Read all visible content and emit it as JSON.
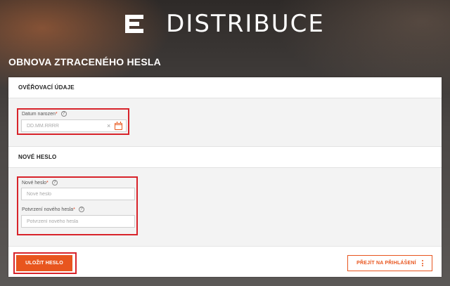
{
  "brand": {
    "name": "DISTRIBUCE",
    "logo_icon": "e-logo-icon"
  },
  "page": {
    "title": "OBNOVA ZTRACENÉHO HESLA"
  },
  "sections": {
    "verification": {
      "title": "OVĚŘOVACÍ ÚDAJE"
    },
    "new_password": {
      "title": "NOVÉ HESLO"
    }
  },
  "fields": {
    "birth_date": {
      "label": "Datum narozen",
      "required_mark": "*",
      "help": "?",
      "placeholder": "DD.MM.RRRR",
      "value": "",
      "clear": "×"
    },
    "new_password": {
      "label": "Nové heslo",
      "required_mark": "*",
      "help": "?",
      "placeholder": "Nové heslo",
      "value": ""
    },
    "confirm_password": {
      "label": "Potvrzení nového hesla",
      "required_mark": "*",
      "help": "?",
      "placeholder": "Potvrzení nového hesla",
      "value": ""
    }
  },
  "buttons": {
    "save": "ULOŽIT HESLO",
    "login": "PŘEJÍT NA PŘIHLÁŠENÍ"
  },
  "colors": {
    "accent": "#e8551e",
    "highlight": "#d8232a"
  }
}
